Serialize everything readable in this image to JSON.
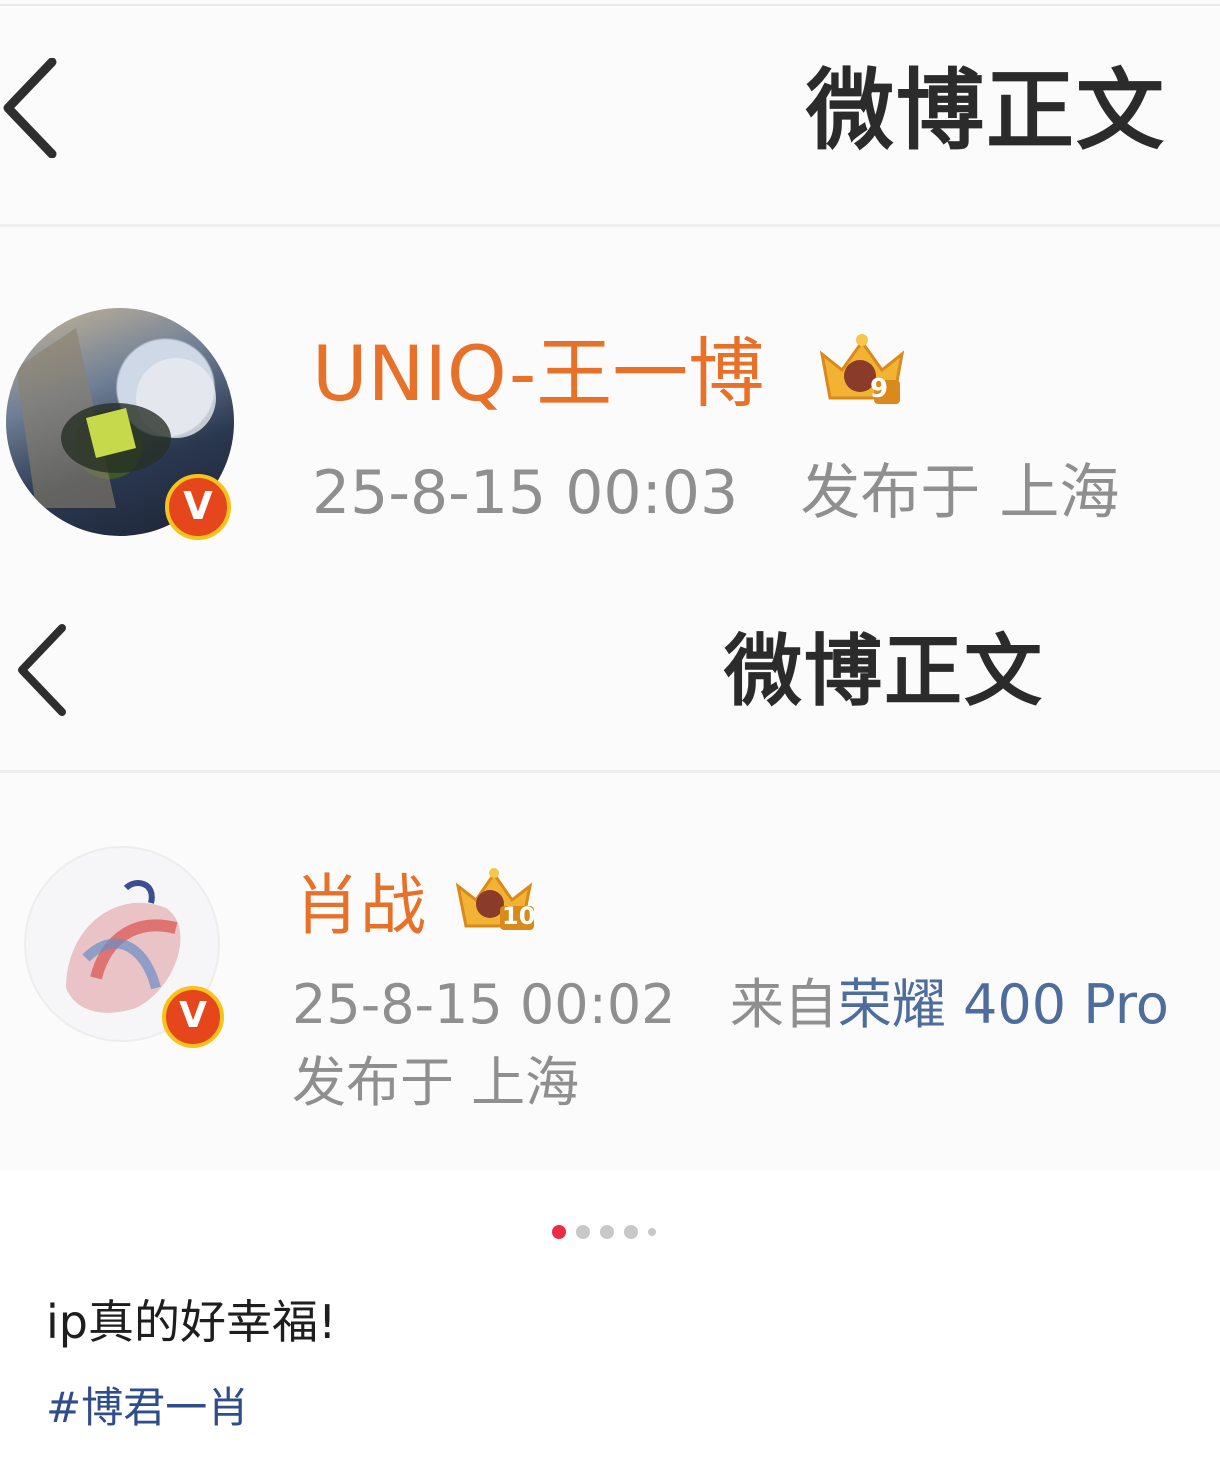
{
  "screenshot_top": {
    "nav_title": "微博正文",
    "user_name": "UNIQ-王一博",
    "crown_level": "9",
    "timestamp": "25-8-15 00:03",
    "publish_location": "发布于 上海"
  },
  "screenshot_bottom": {
    "nav_title": "微博正文",
    "user_name": "肖战",
    "crown_level": "10",
    "timestamp": "25-8-15 00:02",
    "source_prefix": "来自",
    "device": "荣耀 400 Pro",
    "publish_location": "发布于 上海"
  },
  "verified_badge_label": "V",
  "pager": {
    "count": 5,
    "active_index": 0
  },
  "post": {
    "text": "ip真的好幸福!",
    "hashtag": "#博君一肖"
  },
  "colors": {
    "name_orange": "#e8712a",
    "link_blue": "#4e6d9c",
    "hashtag_blue": "#2f4d8a",
    "pager_active": "#ec2b47"
  },
  "icons": [
    "back-chevron-icon",
    "crown-badge-icon",
    "verified-v-icon"
  ]
}
